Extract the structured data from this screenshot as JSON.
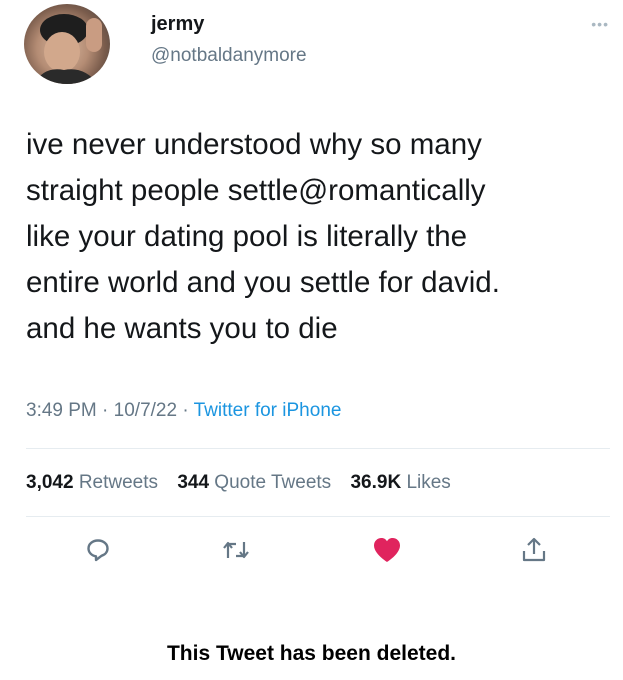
{
  "user": {
    "name": "jermy",
    "handle": "@notbaldanymore"
  },
  "tweet": {
    "lines": [
      "ive never understood why so many",
      "straight people settle@romantically",
      "like your dating pool is literally the",
      "entire world and you settle for david.",
      "and he wants you to die"
    ],
    "time": "3:49 PM",
    "date": "10/7/22",
    "separator": "·",
    "source": "Twitter for iPhone"
  },
  "stats": {
    "retweets_count": "3,042",
    "retweets_label": "Retweets",
    "quotes_count": "344",
    "quotes_label": "Quote Tweets",
    "likes_count": "36.9K",
    "likes_label": "Likes"
  },
  "actions": [
    {
      "icon": "reply-icon"
    },
    {
      "icon": "retweet-icon"
    },
    {
      "icon": "like-icon",
      "liked": true
    },
    {
      "icon": "share-icon"
    }
  ],
  "colors": {
    "text": "#14171a",
    "secondary": "#657786",
    "link": "#1b95e0",
    "like": "#e0245e"
  },
  "deleted_notice": "This Tweet has been deleted."
}
